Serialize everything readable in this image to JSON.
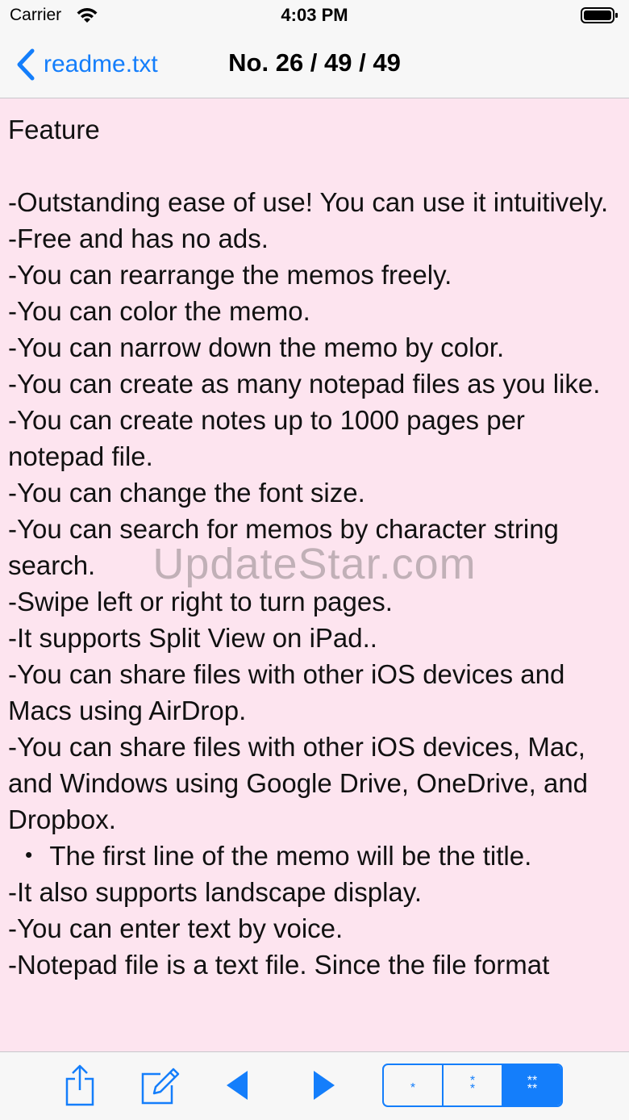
{
  "status_bar": {
    "carrier": "Carrier",
    "time": "4:03 PM"
  },
  "nav": {
    "back_label": "readme.txt",
    "title": "No. 26 / 49 / 49"
  },
  "memo": {
    "text": "Feature\n\n-Outstanding ease of use! You can use it intuitively.\n-Free and has no ads.\n-You can rearrange the memos freely.\n-You can color the memo.\n-You can narrow down the memo by color.\n-You can create as many notepad files as you like.\n-You can create notes up to 1000 pages per notepad file.\n-You can change the font size.\n-You can search for memos by character string search.\n-Swipe left or right to turn pages.\n-It supports Split View on iPad..\n-You can share files with other iOS devices and Macs using AirDrop.\n-You can share files with other iOS devices, Mac, and Windows using Google Drive, OneDrive, and Dropbox.\n ・ The first line of the memo will be the title.\n-It also supports landscape display.\n-You can enter text by voice.\n-Notepad file is a text file. Since the file format",
    "background_color": "#fde4ef"
  },
  "watermark": "UpdateStar.com",
  "toolbar": {
    "icons": [
      "share-icon",
      "compose-icon",
      "previous-page-icon",
      "next-page-icon"
    ],
    "font_size_segments": [
      {
        "label": "*",
        "selected": false
      },
      {
        "label": "*\n*",
        "selected": false
      },
      {
        "label": "**\n**",
        "selected": true
      }
    ]
  },
  "colors": {
    "accent": "#147efb",
    "bar_background": "#f7f7f7"
  }
}
